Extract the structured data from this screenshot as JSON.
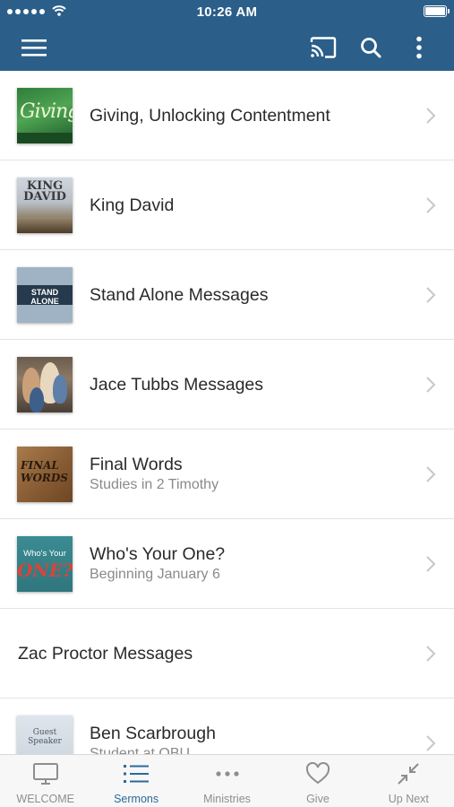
{
  "status_bar": {
    "time": "10:26 AM"
  },
  "nav_bar": {
    "menu_icon": "hamburger-icon",
    "cast_icon": "cast-icon",
    "search_icon": "search-icon",
    "more_icon": "more-vertical-icon"
  },
  "colors": {
    "brand": "#2b5f8a",
    "tab_active": "#2b6a9a",
    "tab_inactive": "#8e8e8e"
  },
  "list": {
    "items": [
      {
        "title": "Giving, Unlocking Contentment",
        "subtitle": "",
        "thumb_text": "Giving"
      },
      {
        "title": "King David",
        "subtitle": "",
        "thumb_text": "KING DAVID"
      },
      {
        "title": "Stand Alone Messages",
        "subtitle": "",
        "thumb_text": "STAND ALONE"
      },
      {
        "title": "Jace Tubbs Messages",
        "subtitle": ""
      },
      {
        "title": "Final Words",
        "subtitle": "Studies in 2 Timothy",
        "thumb_text": "FINAL WORDS"
      },
      {
        "title": "Who's Your One?",
        "subtitle": "Beginning January 6",
        "thumb_text": "Who's Your",
        "thumb_text_2": "ONE?"
      },
      {
        "title": "Zac Proctor Messages",
        "subtitle": ""
      },
      {
        "title": "Ben Scarbrough",
        "subtitle": "Student at OBU",
        "thumb_text": "Guest Speaker"
      }
    ]
  },
  "tab_bar": {
    "tabs": [
      {
        "label": "WELCOME",
        "icon": "tv-icon"
      },
      {
        "label": "Sermons",
        "icon": "list-icon",
        "active": true
      },
      {
        "label": "Ministries",
        "icon": "ellipsis-icon"
      },
      {
        "label": "Give",
        "icon": "heart-icon"
      },
      {
        "label": "Up Next",
        "icon": "collapse-arrows-icon"
      }
    ]
  }
}
